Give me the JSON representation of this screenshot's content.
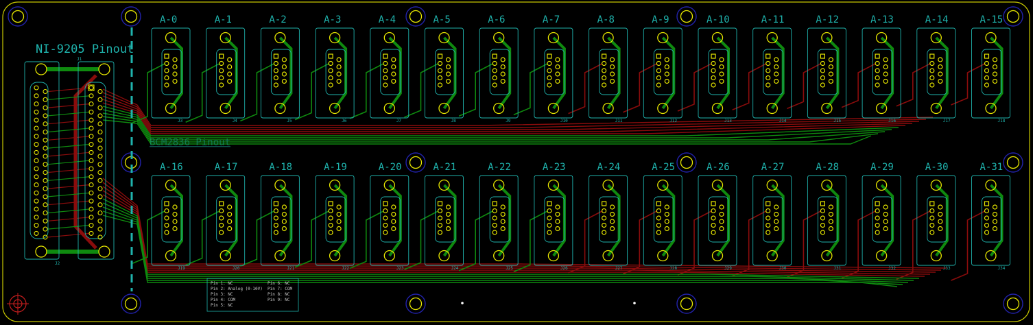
{
  "board": {
    "title": "NI-9205 Pinout",
    "silk_text": "BCM2836 Pinout",
    "main_connector_labels": [
      "J1",
      "J2"
    ],
    "colors": {
      "background": "#000000",
      "outline": "#c8c800",
      "silk": "#1fb3ad",
      "pad": "#e8e800",
      "top_copper": "#0f8a0f",
      "bottom_copper": "#8a0c0c",
      "mount_hole": "#2222aa"
    }
  },
  "connectors_top": [
    "A-0",
    "A-1",
    "A-2",
    "A-3",
    "A-4",
    "A-5",
    "A-6",
    "A-7",
    "A-8",
    "A-9",
    "A-10",
    "A-11",
    "A-12",
    "A-13",
    "A-14",
    "A-15"
  ],
  "connectors_bottom": [
    "A-16",
    "A-17",
    "A-18",
    "A-19",
    "A-20",
    "A-21",
    "A-22",
    "A-23",
    "A-24",
    "A-25",
    "A-26",
    "A-27",
    "A-28",
    "A-29",
    "A-30",
    "A-31"
  ],
  "ref_top": [
    "J3",
    "J4",
    "J5",
    "J6",
    "J7",
    "J8",
    "J9",
    "J10",
    "J11",
    "J12",
    "J13",
    "J14",
    "J15",
    "J16",
    "J17",
    "J18"
  ],
  "ref_bottom": [
    "J19",
    "J20",
    "J21",
    "J22",
    "J23",
    "J24",
    "J25",
    "J26",
    "J27",
    "J28",
    "J29",
    "J30",
    "J31",
    "J32",
    "J33",
    "J34"
  ],
  "pin_legend": {
    "left": [
      "Pin 1: NC",
      "Pin 2: Analog (0-10V)",
      "Pin 3: NC",
      "Pin 4: COM",
      "Pin 5: NC"
    ],
    "right": [
      "Pin 6: NC",
      "Pin 7: COM",
      "Pin 8: NC",
      "Pin 9: NC"
    ]
  }
}
